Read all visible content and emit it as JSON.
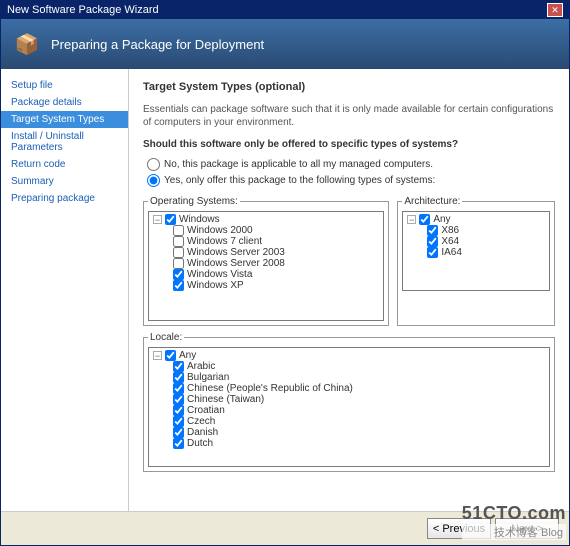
{
  "window": {
    "title": "New Software Package Wizard"
  },
  "banner": {
    "title": "Preparing a Package for Deployment",
    "icon": "📦"
  },
  "sidebar": {
    "items": [
      {
        "label": "Setup file",
        "active": false
      },
      {
        "label": "Package details",
        "active": false
      },
      {
        "label": "Target System Types",
        "active": true
      },
      {
        "label": "Install / Uninstall Parameters",
        "active": false
      },
      {
        "label": "Return code",
        "active": false
      },
      {
        "label": "Summary",
        "active": false
      },
      {
        "label": "Preparing package",
        "active": false
      }
    ]
  },
  "main": {
    "heading": "Target System Types (optional)",
    "description": "Essentials can package software such that it is only made available for certain configurations of computers in your environment.",
    "question": "Should this software only be offered to specific types of systems?",
    "radios": {
      "no": "No, this package is applicable to all my managed computers.",
      "yes": "Yes, only offer this package to the following types of systems:",
      "selected": "yes"
    },
    "osBox": {
      "legend": "Operating Systems:",
      "root": "Windows",
      "items": [
        "Windows 2000",
        "Windows 7 client",
        "Windows Server 2003",
        "Windows Server 2008",
        "Windows Vista",
        "Windows XP"
      ]
    },
    "archBox": {
      "legend": "Architecture:",
      "root": "Any",
      "items": [
        "X86",
        "X64",
        "IA64"
      ]
    },
    "localeBox": {
      "legend": "Locale:",
      "root": "Any",
      "items": [
        "Arabic",
        "Bulgarian",
        "Chinese (People's Republic of China)",
        "Chinese (Taiwan)",
        "Croatian",
        "Czech",
        "Danish",
        "Dutch"
      ]
    }
  },
  "buttons": {
    "previous": "< Previous",
    "next": "Next >"
  },
  "watermark": {
    "line1": "51CTO.com",
    "line2": "技术博客    Blog"
  }
}
